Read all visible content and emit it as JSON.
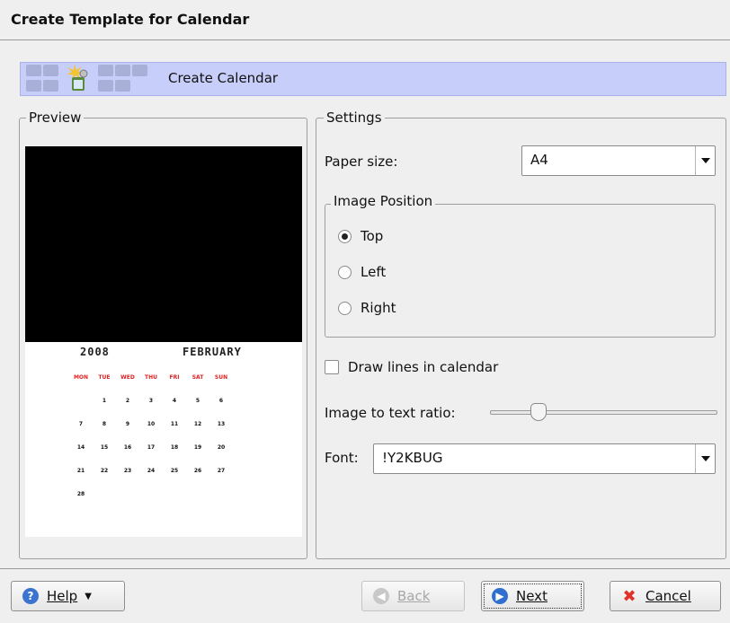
{
  "window": {
    "title": "Create Template for Calendar"
  },
  "banner": {
    "label": "Create Calendar"
  },
  "preview": {
    "title": "Preview",
    "calendar": {
      "year": "2008",
      "month": "FEBRUARY",
      "day_names": [
        "MON",
        "TUE",
        "WED",
        "THU",
        "FRI",
        "SAT",
        "SUN"
      ],
      "weeks": [
        [
          "",
          "1",
          "2",
          "3",
          "4",
          "5",
          "6"
        ],
        [
          "7",
          "8",
          "9",
          "10",
          "11",
          "12",
          "13"
        ],
        [
          "14",
          "15",
          "16",
          "17",
          "18",
          "19",
          "20"
        ],
        [
          "21",
          "22",
          "23",
          "24",
          "25",
          "26",
          "27"
        ],
        [
          "28",
          "",
          "",
          "",
          "",
          "",
          ""
        ]
      ]
    }
  },
  "settings": {
    "title": "Settings",
    "paper_size": {
      "label": "Paper size:",
      "value": "A4"
    },
    "image_position": {
      "title": "Image Position",
      "options": [
        {
          "label": "Top",
          "selected": true
        },
        {
          "label": "Left",
          "selected": false
        },
        {
          "label": "Right",
          "selected": false
        }
      ]
    },
    "draw_lines": {
      "label": "Draw lines in calendar",
      "checked": false
    },
    "ratio": {
      "label": "Image to text ratio:",
      "level": 0.2
    },
    "font": {
      "label": "Font:",
      "value": "!Y2KBUG"
    }
  },
  "buttons": {
    "help": "Help",
    "back": "Back",
    "next": "Next",
    "cancel": "Cancel"
  },
  "colors": {
    "banner": "#c8cefa",
    "help_icon": "#3a73d0",
    "next_icon": "#2f6fcf",
    "cancel_icon": "#e0322a"
  }
}
